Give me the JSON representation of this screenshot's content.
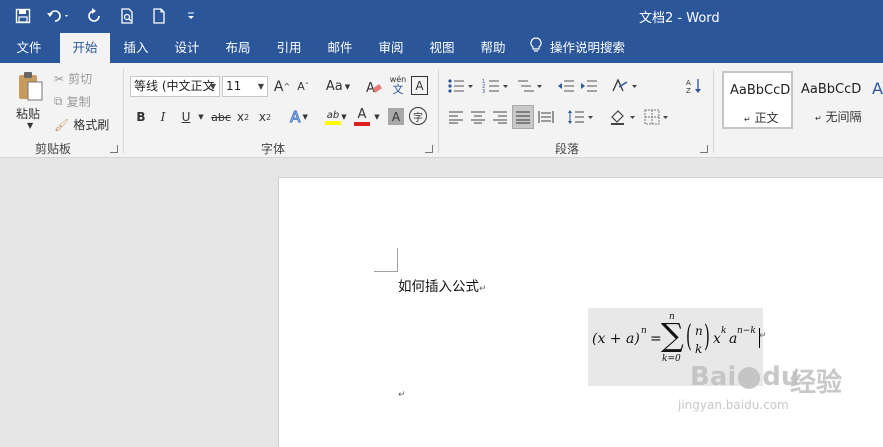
{
  "window": {
    "title": "文档2  -  Word",
    "qat": [
      "save-icon",
      "undo-icon",
      "redo-icon",
      "print-preview-icon",
      "new-document-icon",
      "customize-qat-icon"
    ]
  },
  "tabs": [
    {
      "label": "文件"
    },
    {
      "label": "开始"
    },
    {
      "label": "插入"
    },
    {
      "label": "设计"
    },
    {
      "label": "布局"
    },
    {
      "label": "引用"
    },
    {
      "label": "邮件"
    },
    {
      "label": "审阅"
    },
    {
      "label": "视图"
    },
    {
      "label": "帮助"
    }
  ],
  "tell_me": "操作说明搜索",
  "clipboard": {
    "group": "剪贴板",
    "paste": "粘贴",
    "cut": "剪切",
    "copy": "复制",
    "format_painter": "格式刷"
  },
  "font": {
    "group": "字体",
    "font_name": "等线 (中文正文",
    "font_size": "11",
    "phonetic_top": "wén",
    "phonetic_bottom": "文",
    "char_border": "A",
    "bold": "B",
    "italic": "I",
    "underline": "U",
    "strike": "abc",
    "subscript_base": "x",
    "subscript": "2",
    "superscript_base": "x",
    "superscript": "2",
    "change_case": "Aa",
    "grow_font": "A",
    "shrink_font": "A",
    "text_effects": "A",
    "highlight": "ab",
    "font_color": "A",
    "char_shading": "A",
    "enclose": "字"
  },
  "paragraph": {
    "group": "段落"
  },
  "styles": {
    "items": [
      {
        "sample": "AaBbCcD",
        "name": "正文"
      },
      {
        "sample": "AaBbCcD",
        "name": "无间隔"
      },
      {
        "sample": "A",
        "name": ""
      }
    ]
  },
  "document": {
    "title_paragraph": "如何插入公式",
    "paragraph_mark": "↵",
    "equation": {
      "lhs": "(x + a)",
      "lhs_exp": "n",
      "equals": "=",
      "sum_top": "n",
      "sum_bottom": "k=0",
      "binom_top": "n",
      "binom_bottom": "k",
      "x": "x",
      "x_exp": "k",
      "a": "a",
      "a_exp": "n−k"
    }
  },
  "watermark": {
    "logo": "Bai",
    "paw": "du",
    "brand": "经验",
    "url": "jingyan.baidu.com"
  }
}
